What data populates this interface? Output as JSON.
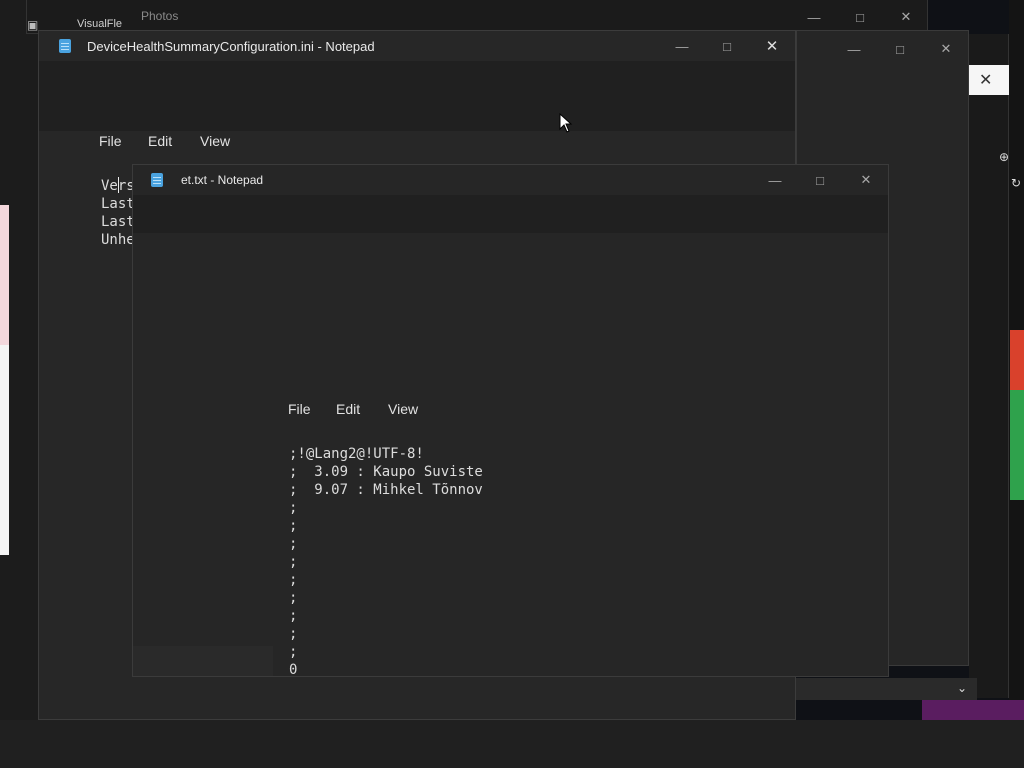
{
  "background": {
    "photos_title": "Photos",
    "visualflex_label": "VisualFle"
  },
  "notepad_main": {
    "title": "DeviceHealthSummaryConfiguration.ini - Notepad",
    "menu": {
      "file": "File",
      "edit": "Edit",
      "view": "View"
    },
    "lines": [
      "Vers",
      "Last",
      "Last",
      "Unhe"
    ]
  },
  "notepad_et": {
    "title": "et.txt - Notepad",
    "menu": {
      "file": "File",
      "edit": "Edit",
      "view": "View"
    },
    "lines": [
      ";!@Lang2@!UTF-8!",
      ";  3.09 : Kaupo Suviste",
      ";  9.07 : Mihkel Tõnnov",
      ";",
      ";",
      ";",
      ";",
      ";",
      ";",
      ";",
      ";",
      ";",
      "0"
    ]
  },
  "colors": {
    "window_bg": "#272727",
    "titlebar_bg": "#202020",
    "accent_blue": "#4aa3e0"
  }
}
